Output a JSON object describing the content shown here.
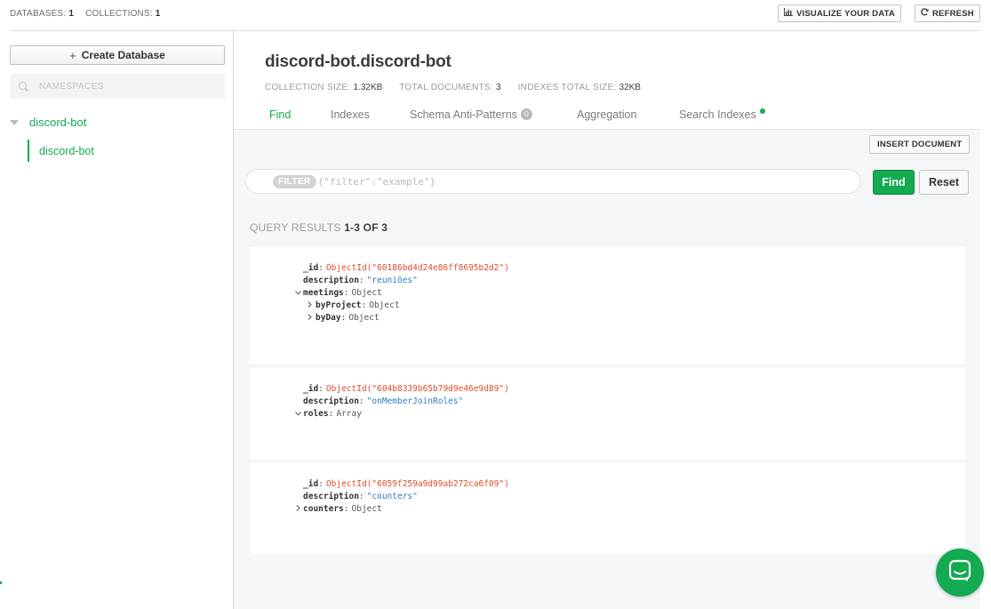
{
  "topbar": {
    "databases_label": "DATABASES:",
    "databases_count": "1",
    "collections_label": "COLLECTIONS:",
    "collections_count": "1",
    "visualize_label": "VISUALIZE YOUR DATA",
    "refresh_label": "REFRESH"
  },
  "sidebar": {
    "create_db_label": "Create Database",
    "search_placeholder": "NAMESPACES",
    "database": "discord-bot",
    "collection": "discord-bot"
  },
  "collection": {
    "title": "discord-bot.discord-bot",
    "size_label": "COLLECTION SIZE:",
    "size_value": "1.32KB",
    "docs_label": "TOTAL DOCUMENTS:",
    "docs_value": "3",
    "indexes_label": "INDEXES TOTAL SIZE:",
    "indexes_value": "32KB"
  },
  "tabs": [
    {
      "label": "Find"
    },
    {
      "label": "Indexes"
    },
    {
      "label": "Schema Anti-Patterns",
      "count": "0"
    },
    {
      "label": "Aggregation"
    },
    {
      "label": "Search Indexes"
    }
  ],
  "query": {
    "insert_label": "INSERT DOCUMENT",
    "filter_chip": "FILTER",
    "filter_placeholder": "{\"filter\":\"example\"}",
    "find_label": "Find",
    "reset_label": "Reset",
    "results_label": "QUERY RESULTS",
    "results_range": "1-3 OF 3"
  },
  "documents": [
    {
      "id": "ObjectId(\"60186bd4d24e86ff8695b2d2\")",
      "description": "\"reuniões\"",
      "f3_key": "meetings",
      "f3_type": "Object",
      "f4_key": "byProject",
      "f4_type": "Object",
      "f5_key": "byDay",
      "f5_type": "Object"
    },
    {
      "id": "ObjectId(\"604b8339b65b79d9e46e9d89\")",
      "description": "\"onMemberJoinRoles\"",
      "f3_key": "roles",
      "f3_type": "Array"
    },
    {
      "id": "ObjectId(\"6059f259a9d99ab272ca6f09\")",
      "description": "\"counters\"",
      "f3_key": "counters",
      "f3_type": "Object"
    }
  ],
  "labels": {
    "id_key": "_id",
    "desc_key": "description",
    "colon": ":"
  },
  "colors": {
    "accent": "#13aa52",
    "objectid": "#e14d2a",
    "string": "#2f7ec2"
  },
  "icons": {
    "visualize": "bar-chart-icon",
    "refresh": "refresh-icon",
    "search": "search-icon",
    "chat": "chat-icon"
  }
}
